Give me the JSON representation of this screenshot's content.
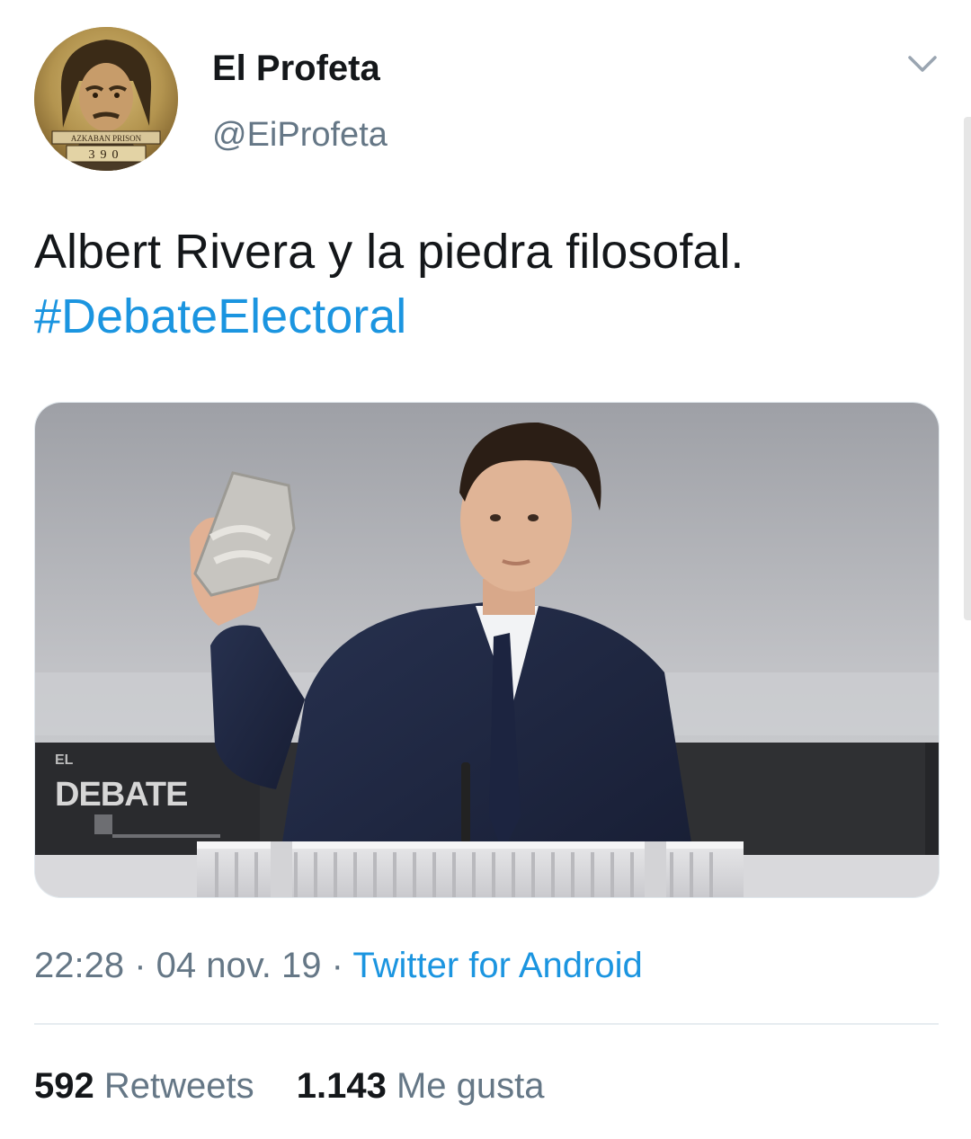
{
  "author": {
    "display_name": "El Profeta",
    "handle": "@EiProfeta",
    "avatar_icon": "wanted-poster-avatar-icon",
    "avatar_caption": "AZKABAN PRISON",
    "avatar_numbers": "390"
  },
  "tweet": {
    "text": "Albert Rivera y la piedra filosofal.",
    "hashtag": "#DebateElectoral"
  },
  "media": {
    "description_icon": "photo-debate-icon",
    "overlay_logo_small": "EL",
    "overlay_logo": "DEBATE"
  },
  "meta": {
    "time": "22:28",
    "separator": " · ",
    "date": "04 nov. 19",
    "source": "Twitter for Android"
  },
  "stats": {
    "retweets_count": "592",
    "retweets_label": "Retweets",
    "likes_count": "1.143",
    "likes_label": "Me gusta"
  },
  "colors": {
    "link": "#1b95e0",
    "text": "#14171a",
    "secondary": "#657786"
  }
}
